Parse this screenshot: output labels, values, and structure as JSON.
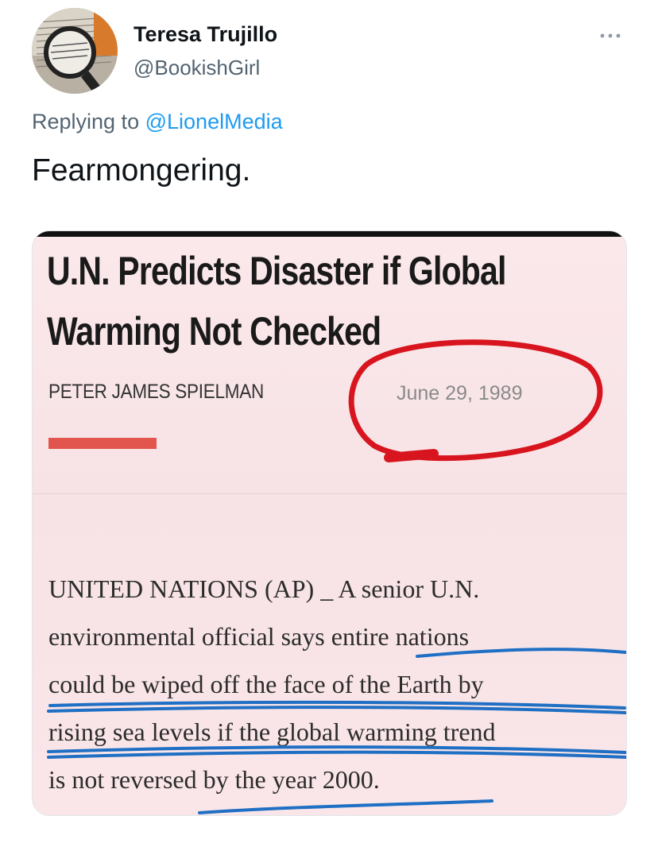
{
  "tweet": {
    "author_name": "Teresa Trujillo",
    "author_handle": "@BookishGirl",
    "more_label": "•••",
    "replying_prefix": "Replying to",
    "replying_to": "@LionelMedia",
    "text": "Fearmongering."
  },
  "media": {
    "headline": "U.N. Predicts Disaster if Global Warming Not Checked",
    "byline": "PETER JAMES SPIELMAN",
    "date": "June 29, 1989",
    "body_lines": [
      "UNITED NATIONS (AP) _ A senior U.N.",
      "environmental official says entire nations",
      "could be wiped off the face of the Earth by",
      "rising sea levels if the global warming trend",
      "is not reversed by the year 2000."
    ],
    "annotation_colors": {
      "circle": "#d8151e",
      "underline": "#1f6fc4",
      "accent_bar": "#e2554f"
    }
  },
  "icons": {
    "avatar": "book-magnifier-avatar",
    "more": "more-horizontal-icon"
  }
}
